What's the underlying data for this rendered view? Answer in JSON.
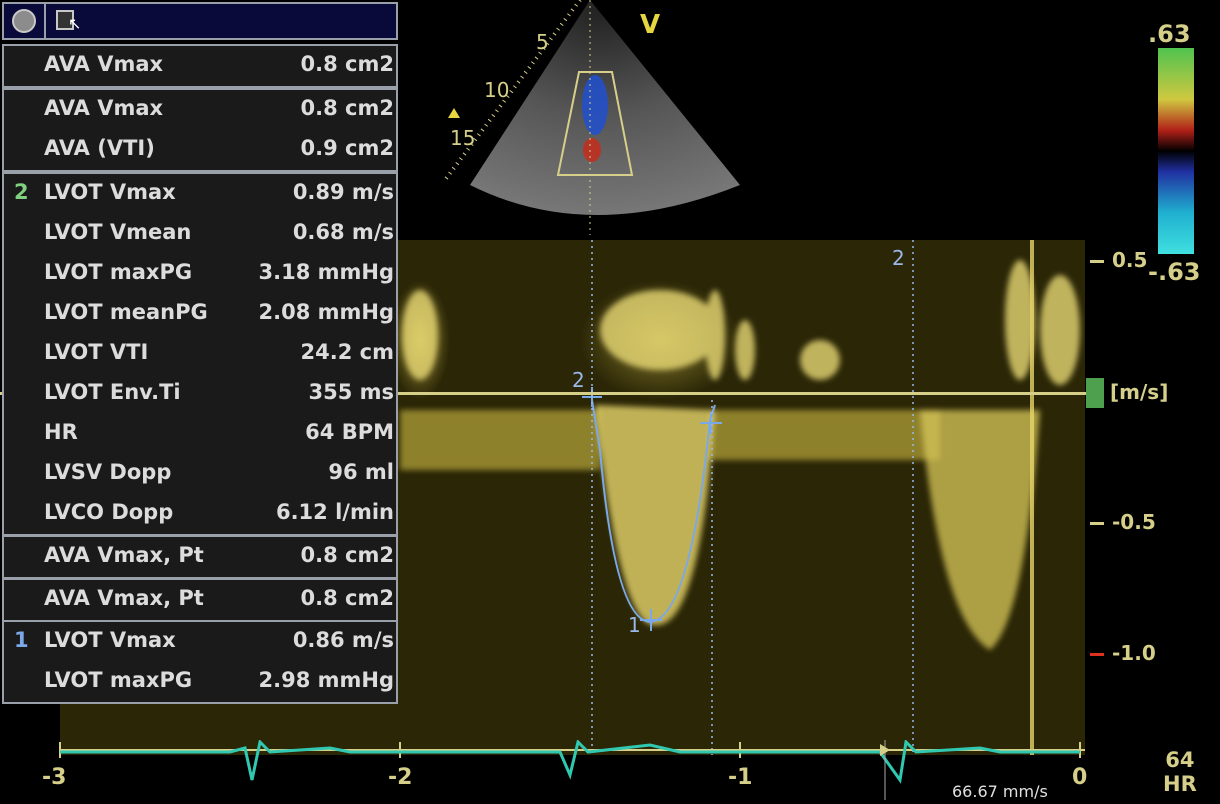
{
  "sector": {
    "view_label": "V",
    "depth_marks": [
      "5",
      "10",
      "15"
    ]
  },
  "panel": {
    "groups": [
      {
        "rows": [
          {
            "index": "",
            "label": "AVA Vmax",
            "value": "0.8 cm2"
          }
        ]
      },
      {
        "rows": [
          {
            "index": "",
            "label": "AVA Vmax",
            "value": "0.8 cm2"
          },
          {
            "index": "",
            "label": "AVA (VTI)",
            "value": "0.9 cm2"
          }
        ]
      },
      {
        "index_color": "#7fd07f",
        "rows": [
          {
            "index": "2",
            "label": "LVOT Vmax",
            "value": "0.89 m/s"
          },
          {
            "index": "",
            "label": "LVOT Vmean",
            "value": "0.68 m/s"
          },
          {
            "index": "",
            "label": "LVOT maxPG",
            "value": "3.18 mmHg"
          },
          {
            "index": "",
            "label": "LVOT meanPG",
            "value": "2.08 mmHg"
          },
          {
            "index": "",
            "label": "LVOT VTI",
            "value": "24.2 cm"
          },
          {
            "index": "",
            "label": "LVOT Env.Ti",
            "value": "355 ms"
          },
          {
            "index": "",
            "label": "HR",
            "value": "64 BPM"
          },
          {
            "index": "",
            "label": "LVSV Dopp",
            "value": "96 ml"
          },
          {
            "index": "",
            "label": "LVCO Dopp",
            "value": "6.12 l/min"
          }
        ]
      },
      {
        "rows": [
          {
            "index": "",
            "label": "AVA Vmax, Pt",
            "value": "0.8 cm2"
          }
        ]
      },
      {
        "rows": [
          {
            "index": "",
            "label": "AVA Vmax, Pt",
            "value": "0.8 cm2"
          }
        ]
      },
      {
        "index_color": "#7aa8e8",
        "rows": [
          {
            "index": "1",
            "label": "LVOT Vmax",
            "value": "0.86 m/s"
          },
          {
            "index": "",
            "label": "LVOT maxPG",
            "value": "2.98 mmHg"
          }
        ]
      }
    ]
  },
  "colorbar": {
    "top": ".63",
    "bottom": "-.63"
  },
  "velocity_scale": {
    "labels": [
      "0.5",
      "[m/s]",
      "-0.5",
      "-1.0"
    ]
  },
  "trace_markers": {
    "top_marker": "2",
    "baseline_marker": "2",
    "peak_marker": "1"
  },
  "time_axis": {
    "labels": [
      "-3",
      "-2",
      "-1",
      "0"
    ],
    "sweep_speed": "66.67 mm/s"
  },
  "heart_rate": {
    "value": "64",
    "label": "HR"
  },
  "colors": {
    "accent_yellow": "#d6cf8a",
    "trace_blue": "#7aa8e8",
    "ecg": "#30c8b0"
  }
}
